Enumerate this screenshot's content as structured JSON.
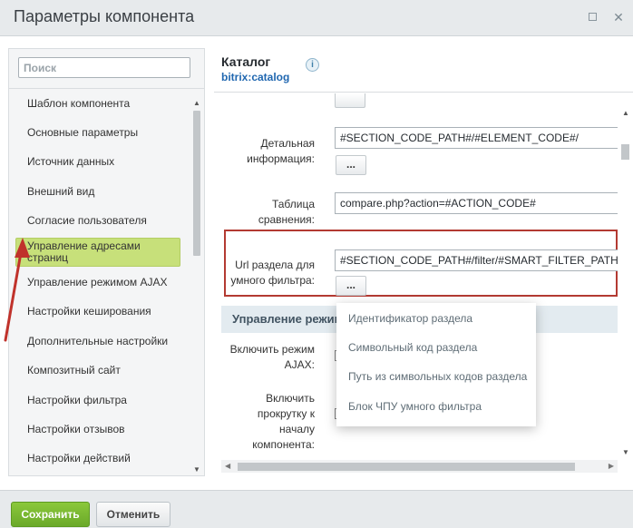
{
  "window": {
    "title": "Параметры компонента",
    "maximize_icon": "maximize-icon",
    "close_icon": "close-icon"
  },
  "search": {
    "placeholder": "Поиск",
    "value": ""
  },
  "sidebar": {
    "items": [
      {
        "label": "Шаблон компонента"
      },
      {
        "label": "Основные параметры"
      },
      {
        "label": "Источник данных"
      },
      {
        "label": "Внешний вид"
      },
      {
        "label": "Согласие пользователя"
      },
      {
        "label": "Управление адресами страниц",
        "active": true
      },
      {
        "label": "Управление режимом AJAX"
      },
      {
        "label": "Настройки кеширования"
      },
      {
        "label": "Дополнительные настройки"
      },
      {
        "label": "Композитный сайт"
      },
      {
        "label": "Настройки фильтра"
      },
      {
        "label": "Настройки отзывов"
      },
      {
        "label": "Настройки действий"
      }
    ]
  },
  "component": {
    "title": "Каталог",
    "code": "bitrix:catalog",
    "info_icon": "i"
  },
  "form": {
    "detail_label": "Детальная информация:",
    "detail_value": "#SECTION_CODE_PATH#/#ELEMENT_CODE#/",
    "compare_label": "Таблица сравнения:",
    "compare_value": "compare.php?action=#ACTION_CODE#",
    "smart_filter_label": "Url раздела для умного фильтра:",
    "smart_filter_value": "#SECTION_CODE_PATH#/filter/#SMART_FILTER_PATH#/apply/",
    "dots_label": "...",
    "section_title": "Управление режимом AJAX",
    "ajax_label": "Включить режим AJAX:",
    "scroll_label": "Включить прокрутку к началу компонента:"
  },
  "dropdown": {
    "items": [
      "Идентификатор раздела",
      "Символьный код раздела",
      "Путь из символьных кодов раздела",
      "Блок ЧПУ умного фильтра"
    ]
  },
  "footer": {
    "save_label": "Сохранить",
    "cancel_label": "Отменить"
  },
  "colors": {
    "accent_green": "#7ab833",
    "active_item": "#c7e07a",
    "highlight_red": "#b33a32",
    "link_blue": "#2067b0"
  }
}
